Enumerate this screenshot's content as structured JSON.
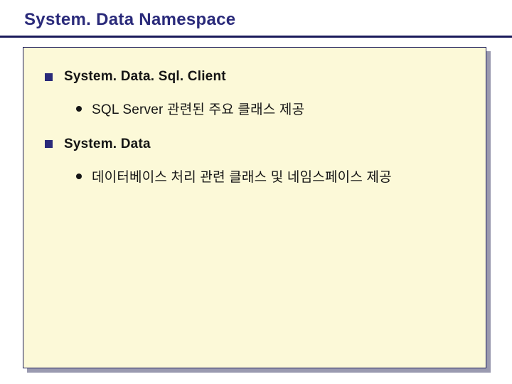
{
  "slide": {
    "title": "System. Data Namespace",
    "items": [
      {
        "label": "System. Data. Sql. Client",
        "sub": [
          "SQL Server 관련된 주요 클래스 제공"
        ]
      },
      {
        "label": "System. Data",
        "sub": [
          "데이터베이스 처리 관련 클래스 및 네임스페이스 제공"
        ]
      }
    ]
  },
  "colors": {
    "titleColor": "#2a2a7a",
    "panelBg": "#fcf9d8",
    "borderColor": "#1a1a5a"
  }
}
